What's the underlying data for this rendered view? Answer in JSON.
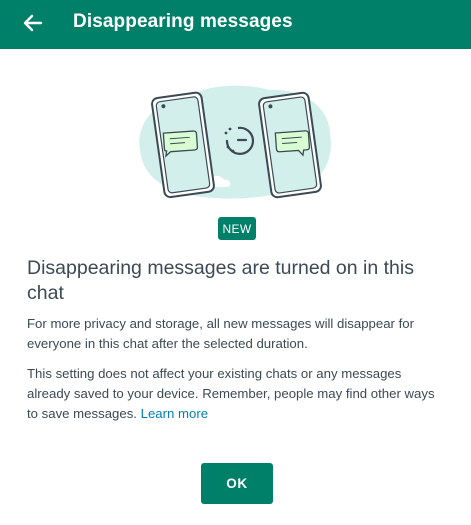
{
  "header": {
    "title": "Disappearing messages"
  },
  "badge": "NEW",
  "heading": "Disappearing messages are turned on in this chat",
  "body": {
    "paragraph1": "For more privacy and storage, all new messages will disappear for everyone in this chat after the selected duration.",
    "paragraph2": "This setting does not affect your existing chats or any messages already saved to your device. Remember, people may find other ways to save messages.",
    "learn_more": "Learn more"
  },
  "ok_label": "OK",
  "icons": {
    "back": "arrow-left-icon",
    "illustration": "two-phones-timer-illustration"
  },
  "colors": {
    "primary": "#008069",
    "text": "#3b4a54",
    "link": "#027eb5",
    "illustration_blob": "#d3efeb",
    "message_bubble": "#d9fdd3"
  }
}
